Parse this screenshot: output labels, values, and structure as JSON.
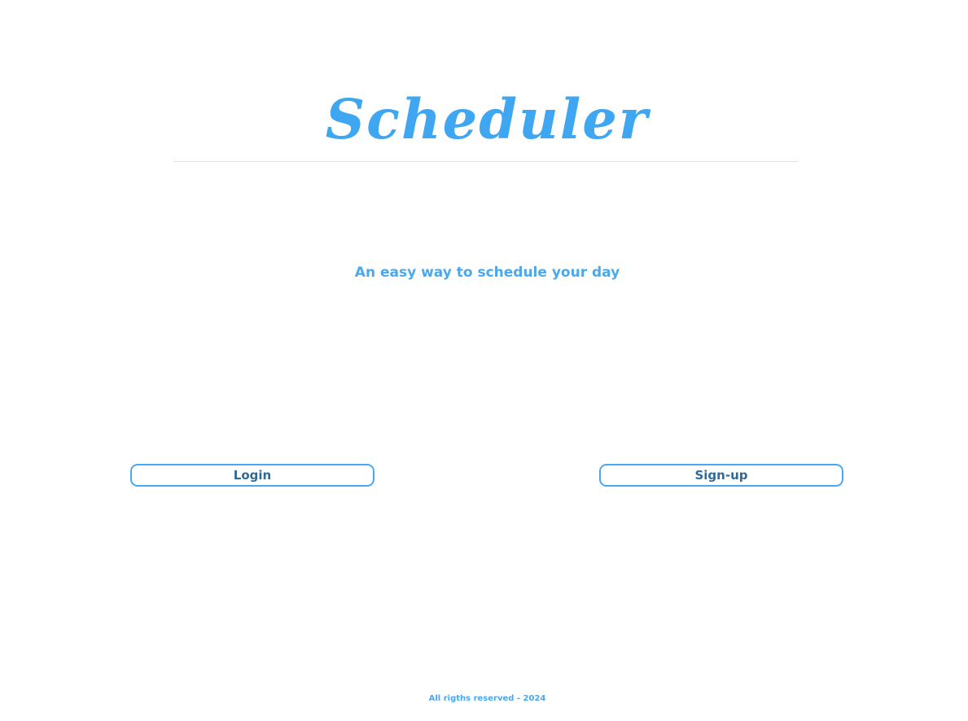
{
  "header": {
    "title": "Scheduler"
  },
  "hero": {
    "tagline": "An easy way to schedule your day"
  },
  "actions": {
    "login_label": "Login",
    "signup_label": "Sign-up"
  },
  "footer": {
    "text": "All rigths reserved - 2024"
  },
  "colors": {
    "accent": "#3fa6f2",
    "button_text": "#2e6a9c",
    "divider": "#e2e5e9"
  }
}
